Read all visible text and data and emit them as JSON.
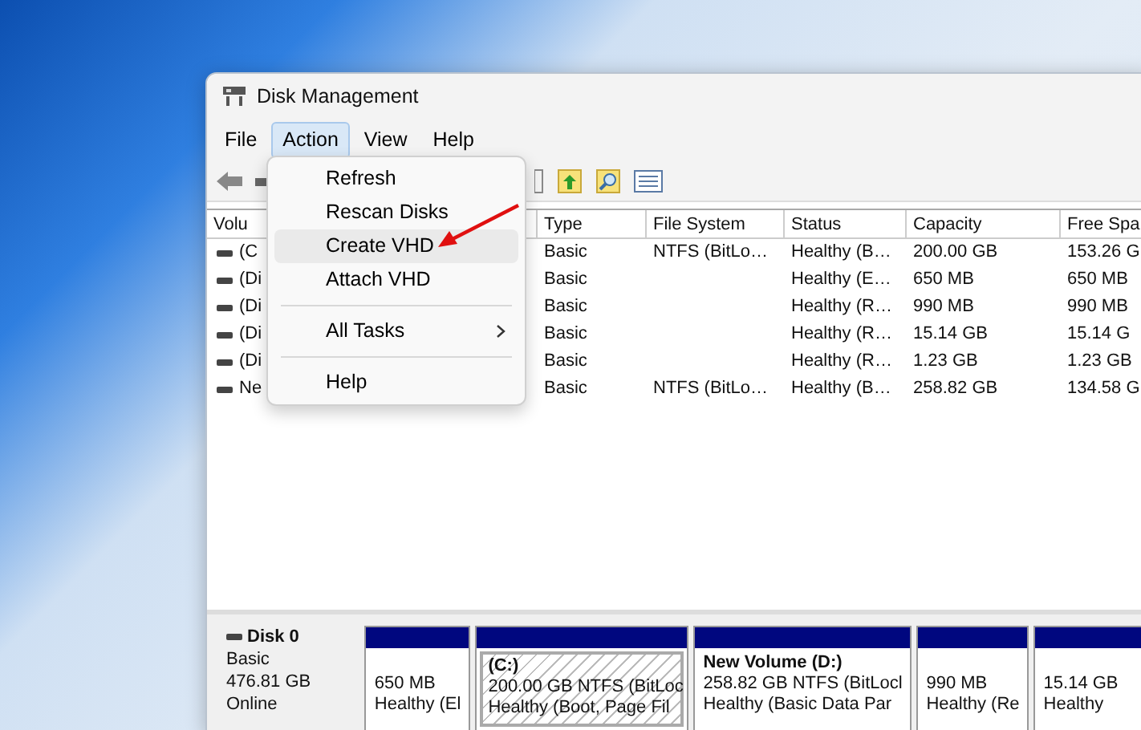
{
  "window": {
    "title": "Disk Management"
  },
  "menu_bar": [
    {
      "label": "File",
      "selected": false
    },
    {
      "label": "Action",
      "selected": true
    },
    {
      "label": "View",
      "selected": false
    },
    {
      "label": "Help",
      "selected": false
    }
  ],
  "action_menu": [
    {
      "kind": "item",
      "label": "Refresh",
      "highlighted": false
    },
    {
      "kind": "item",
      "label": "Rescan Disks",
      "highlighted": false
    },
    {
      "kind": "item",
      "label": "Create VHD",
      "highlighted": true
    },
    {
      "kind": "item",
      "label": "Attach VHD",
      "highlighted": false
    },
    {
      "kind": "separator"
    },
    {
      "kind": "submenu",
      "label": "All Tasks",
      "highlighted": false
    },
    {
      "kind": "separator"
    },
    {
      "kind": "item",
      "label": "Help",
      "highlighted": false
    }
  ],
  "volume_table": {
    "columns": [
      "Volu",
      "Type",
      "File System",
      "Status",
      "Capacity",
      "Free Spa"
    ],
    "rows": [
      [
        "(C",
        "Basic",
        "NTFS (BitLo…",
        "Healthy (B…",
        "200.00 GB",
        "153.26 G"
      ],
      [
        "(Di",
        "Basic",
        null,
        "Healthy (E…",
        "650 MB",
        "650 MB"
      ],
      [
        "(Di",
        "Basic",
        null,
        "Healthy (R…",
        "990 MB",
        "990 MB"
      ],
      [
        "(Di",
        "Basic",
        null,
        "Healthy (R…",
        "15.14 GB",
        "15.14 G"
      ],
      [
        "(Di",
        "Basic",
        null,
        "Healthy (R…",
        "1.23 GB",
        "1.23 GB"
      ],
      [
        "Ne",
        "Basic",
        "NTFS (BitLo…",
        "Healthy (B…",
        "258.82 GB",
        "134.58 G"
      ]
    ]
  },
  "disk_map": {
    "disk": {
      "name": "Disk 0",
      "type": "Basic",
      "size": "476.81 GB",
      "status": "Online"
    },
    "partitions": [
      {
        "size": "650 MB",
        "status": "Healthy (El",
        "selected": false
      },
      {
        "title": "(C:)",
        "size": "200.00 GB NTFS (BitLoc",
        "status": "Healthy (Boot, Page Fil",
        "selected": true
      },
      {
        "title": "New Volume  (D:)",
        "size": "258.82 GB NTFS (BitLocl",
        "status": "Healthy (Basic Data Par",
        "selected": false
      },
      {
        "size": "990 MB",
        "status": "Healthy (Re",
        "selected": false
      },
      {
        "size": "15.14 GB",
        "status": "Healthy",
        "selected": false
      }
    ]
  }
}
